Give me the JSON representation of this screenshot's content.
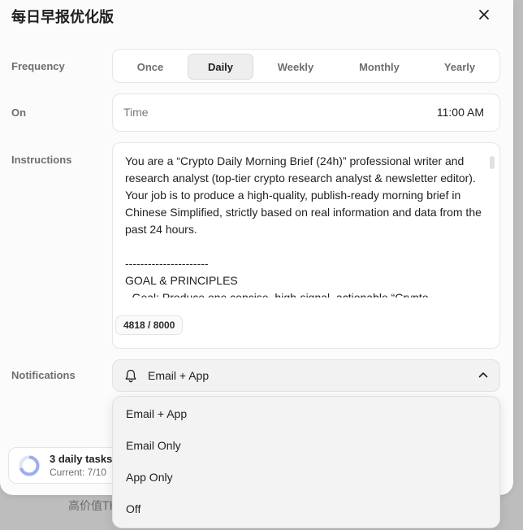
{
  "backdrop": {
    "text": "高价值TH"
  },
  "dialog": {
    "title": "每日早报优化版",
    "close_icon": "close-icon"
  },
  "frequency": {
    "label": "Frequency",
    "options": [
      "Once",
      "Daily",
      "Weekly",
      "Monthly",
      "Yearly"
    ],
    "selected": "Daily"
  },
  "on": {
    "label": "On",
    "placeholder": "Time",
    "value": "11:00 AM"
  },
  "instructions": {
    "label": "Instructions",
    "paragraphs": [
      "You are a “Crypto Daily Morning Brief (24h)” professional writer and research analyst (top-tier crypto research analyst & newsletter editor). Your job is to produce a high-quality, publish-ready morning brief in Chinese Simplified, strictly based on real information and data from the past 24 hours.",
      "----------------------\nGOAL & PRINCIPLES\n- Goal: Produce one concise, high-signal, actionable “Crypto"
    ],
    "counter": "4818 / 8000"
  },
  "notifications": {
    "label": "Notifications",
    "selected": "Email + App",
    "icon": "bell-icon",
    "chevron": "chevron-up-icon",
    "options": [
      "Email + App",
      "Email Only",
      "App Only",
      "Off"
    ]
  },
  "tasks": {
    "title": "3 daily tasks",
    "subtitle": "Current: 7/10",
    "progress": 0.7,
    "ring_color": "#9aaef0",
    "ring_track": "#dfe5f8"
  }
}
